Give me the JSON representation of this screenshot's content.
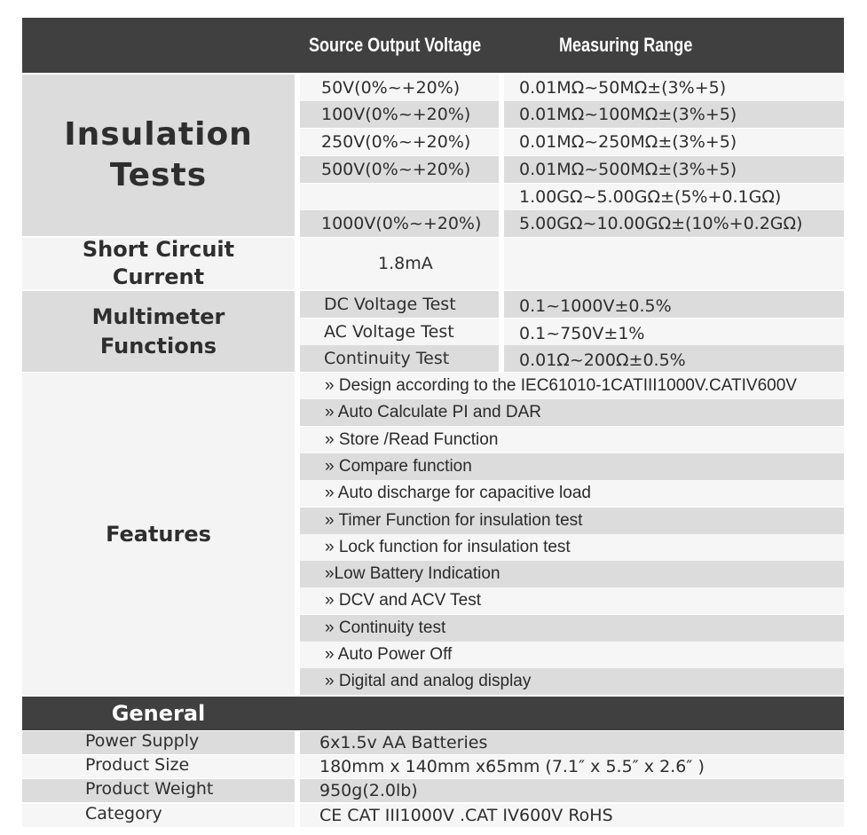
{
  "header": {
    "col1": "Source Output Voltage",
    "col2": "Measuring Range"
  },
  "insulation": {
    "label_line1": "Insulation",
    "label_line2": "Tests",
    "rows": [
      {
        "voltage": "50V(0%~+20%)",
        "range": "0.01MΩ~50MΩ±(3%+5)"
      },
      {
        "voltage": "100V(0%~+20%)",
        "range": "0.01MΩ~100MΩ±(3%+5)"
      },
      {
        "voltage": "250V(0%~+20%)",
        "range": "0.01MΩ~250MΩ±(3%+5)"
      },
      {
        "voltage": "500V(0%~+20%)",
        "range": "0.01MΩ~500MΩ±(3%+5)"
      },
      {
        "voltage": "",
        "range": "1.00GΩ~5.00GΩ±(5%+0.1GΩ)"
      },
      {
        "voltage": "1000V(0%~+20%)",
        "range": "5.00GΩ~10.00GΩ±(10%+0.2GΩ)"
      }
    ]
  },
  "short_circuit": {
    "label_line1": "Short Circuit",
    "label_line2": "Current",
    "value": "1.8mA"
  },
  "multimeter": {
    "label_line1": "Multimeter",
    "label_line2": "Functions",
    "rows": [
      {
        "name": "DC Voltage Test",
        "range": "0.1~1000V±0.5%"
      },
      {
        "name": "AC Voltage Test",
        "range": "0.1~750V±1%"
      },
      {
        "name": "Continuity Test",
        "range": "0.01Ω~200Ω±0.5%"
      }
    ]
  },
  "features": {
    "label": "Features",
    "items": [
      "» Design according to the IEC61010-1CATIII1000V.CATIV600V",
      "» Auto Calculate PI and DAR",
      "» Store /Read Function",
      "» Compare function",
      "» Auto discharge for capacitive load",
      "» Timer Function for insulation test",
      "» Lock function for insulation test",
      "»Low Battery Indication",
      "» DCV and ACV Test",
      "» Continuity test",
      "» Auto Power Off",
      "» Digital and analog display"
    ]
  },
  "general": {
    "title": "General",
    "rows": [
      {
        "label": "Power Supply",
        "value": "6x1.5v AA Batteries"
      },
      {
        "label": "Product Size",
        "value": "180mm x 140mm x65mm (7.1″  x 5.5″  x 2.6″ )"
      },
      {
        "label": "Product Weight",
        "value": "950g(2.0lb)"
      },
      {
        "label": "Category",
        "value": "CE  CAT III1000V .CAT IV600V RoHS"
      }
    ]
  }
}
